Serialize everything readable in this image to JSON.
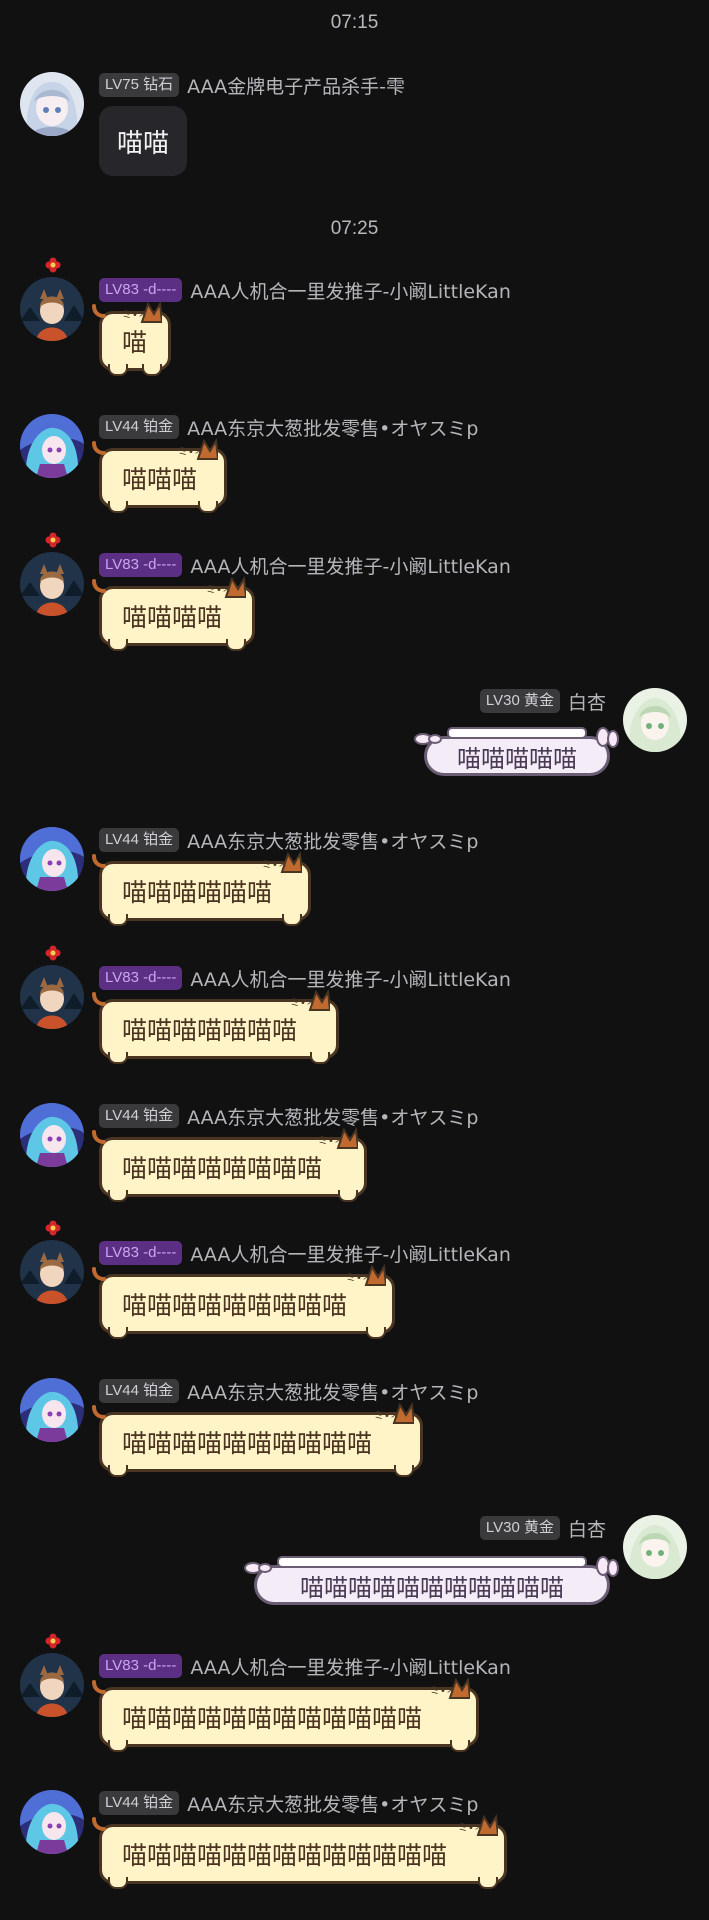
{
  "times": [
    "07:15",
    "07:25"
  ],
  "users": {
    "xue": {
      "level": "LV75 钻石",
      "name": "AAA金牌电子产品杀手-雫"
    },
    "kan": {
      "level": "LV83 -d----",
      "name": "AAA人机合一里发推子-小阚LittleKan"
    },
    "oyasumi": {
      "level": "LV44 铂金",
      "name": "AAA东京大葱批发零售•オヤスミp"
    },
    "baixing": {
      "level": "LV30 黄金",
      "name": "白杏"
    }
  },
  "messages": [
    {
      "user": "xue",
      "text": "喵喵"
    },
    {
      "user": "kan",
      "text": "喵"
    },
    {
      "user": "oyasumi",
      "text": "喵喵喵"
    },
    {
      "user": "kan",
      "text": "喵喵喵喵"
    },
    {
      "user": "baixing",
      "text": "喵喵喵喵喵"
    },
    {
      "user": "oyasumi",
      "text": "喵喵喵喵喵喵"
    },
    {
      "user": "kan",
      "text": "喵喵喵喵喵喵喵"
    },
    {
      "user": "oyasumi",
      "text": "喵喵喵喵喵喵喵喵"
    },
    {
      "user": "kan",
      "text": "喵喵喵喵喵喵喵喵喵"
    },
    {
      "user": "oyasumi",
      "text": "喵喵喵喵喵喵喵喵喵喵"
    },
    {
      "user": "baixing",
      "text": "喵喵喵喵喵喵喵喵喵喵喵"
    },
    {
      "user": "kan",
      "text": "喵喵喵喵喵喵喵喵喵喵喵喵"
    },
    {
      "user": "oyasumi",
      "text": "喵喵喵喵喵喵喵喵喵喵喵喵喵"
    }
  ]
}
